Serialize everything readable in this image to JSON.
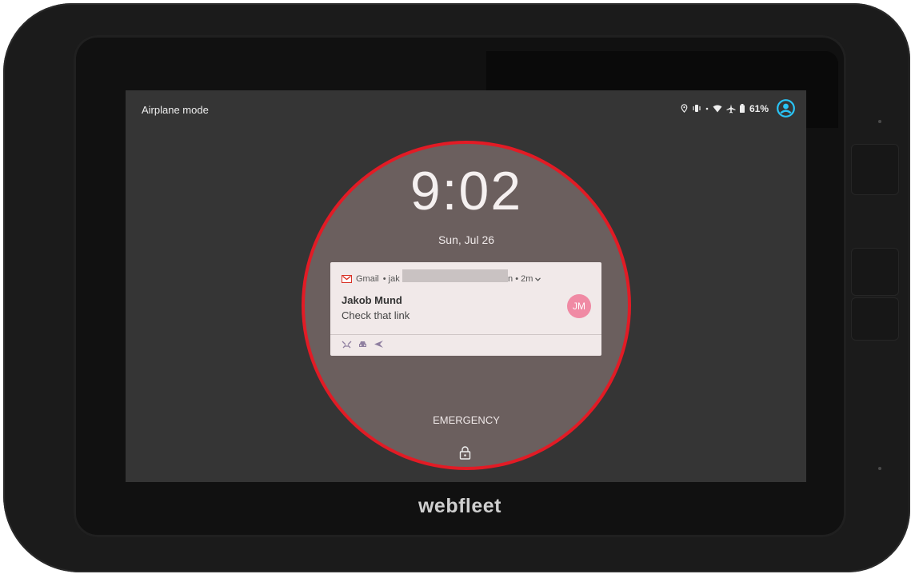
{
  "status_bar": {
    "mode_label": "Airplane mode",
    "battery_level": "61%",
    "icons": [
      "location-icon",
      "vibrate-icon",
      "wifi-icon",
      "airplane-icon",
      "battery-icon",
      "account-icon"
    ]
  },
  "lock_screen": {
    "clock": "9:02",
    "date": "Sun, Jul 26",
    "emergency_label": "EMERGENCY"
  },
  "notification": {
    "app": "Gmail",
    "account_prefix": "• jak",
    "account_suffix": "n",
    "time_ago": "• 2m",
    "sender": "Jakob Mund",
    "message": "Check that link",
    "avatar_initials": "JM",
    "action_icons": [
      "archive-icon",
      "car-icon",
      "reply-icon"
    ]
  },
  "device": {
    "brand": "webfleet"
  },
  "colors": {
    "highlight_ring": "#e21b25",
    "screen_bg": "#353535",
    "avatar": "#f08aa4",
    "account_icon": "#29c4f6"
  }
}
